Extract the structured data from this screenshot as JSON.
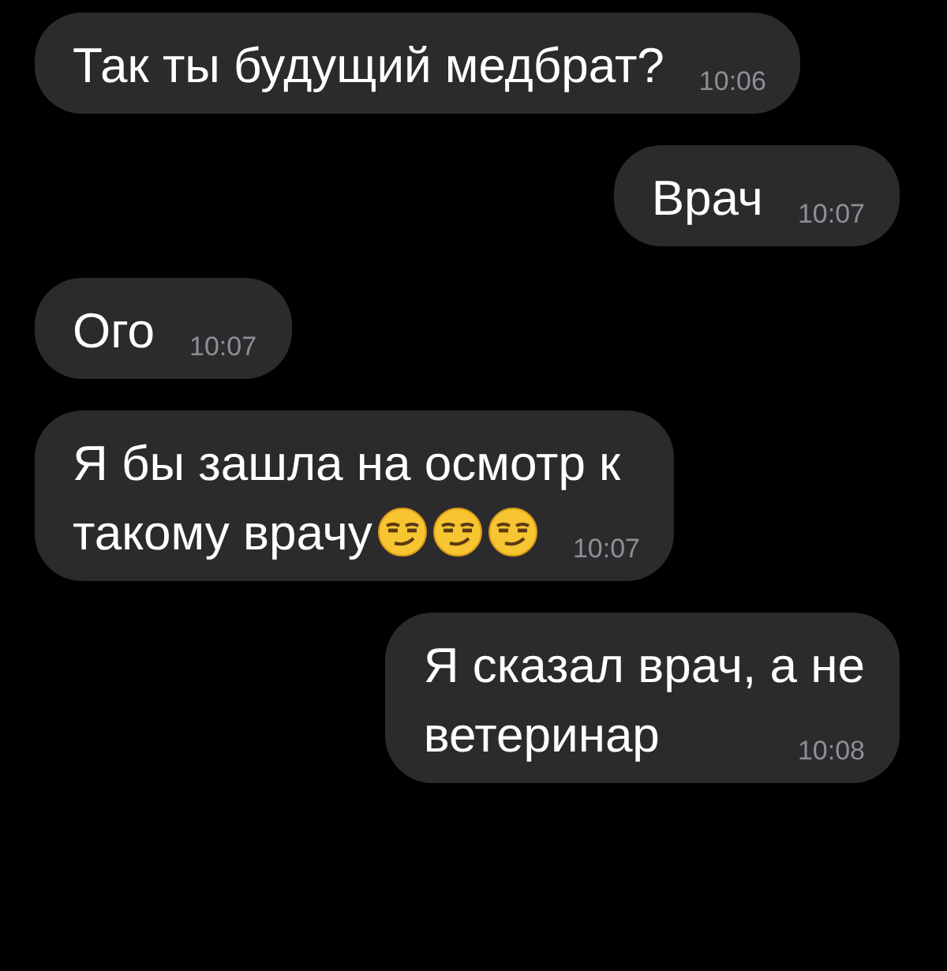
{
  "messages": [
    {
      "kind": "incoming",
      "lines": [
        "Так ты будущий медбрат?"
      ],
      "time": "10:06"
    },
    {
      "kind": "outgoing",
      "lines": [
        "Врач"
      ],
      "time": "10:07"
    },
    {
      "kind": "incoming",
      "lines": [
        "Ого"
      ],
      "time": "10:07"
    },
    {
      "kind": "incoming",
      "lines": [
        "Я бы зашла на осмотр к",
        "такому врачу"
      ],
      "time": "10:07",
      "trailing_icons": [
        {
          "kind": "smirk"
        },
        {
          "kind": "smirk"
        },
        {
          "kind": "smirk"
        }
      ]
    },
    {
      "kind": "outgoing",
      "lines": [
        "Я сказал врач, а не",
        "ветеринар"
      ],
      "time": "10:08"
    }
  ]
}
